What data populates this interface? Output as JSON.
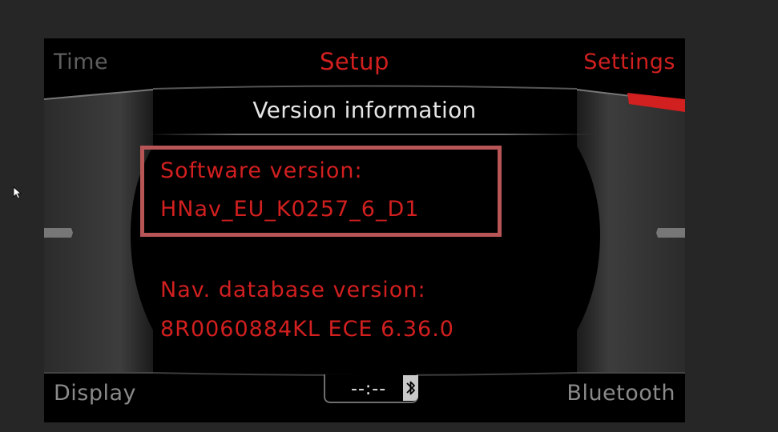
{
  "corners": {
    "top_left": "Time",
    "top_center": "Setup",
    "top_right": "Settings",
    "bottom_left": "Display",
    "bottom_right": "Bluetooth"
  },
  "panel": {
    "title": "Version information",
    "software_label": "Software version:",
    "software_value": "HNav_EU_K0257_6_D1",
    "database_label": "Nav. database version:",
    "database_value": "8R0060884KL ECE 6.36.0"
  },
  "status": {
    "clock": "--:--",
    "bluetooth_icon": "bluetooth-icon"
  },
  "colors": {
    "accent_red": "#d21f1f",
    "highlight_box": "#b85556",
    "title_text": "#e6e6e6",
    "inactive_menu": "#5e5e5e"
  }
}
